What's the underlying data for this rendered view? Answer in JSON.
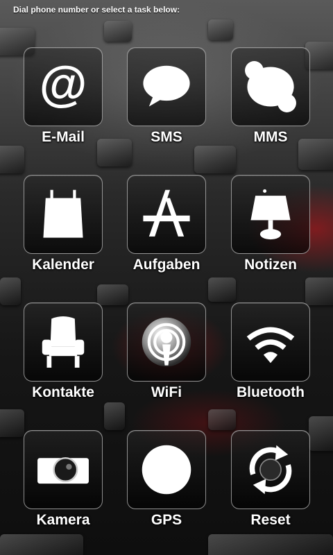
{
  "header": {
    "instruction": "Dial phone number or select a task below:"
  },
  "tiles": [
    {
      "label": "E-Mail",
      "icon": "at-sign-icon"
    },
    {
      "label": "SMS",
      "icon": "speech-bubble-icon"
    },
    {
      "label": "MMS",
      "icon": "skype-cloud-icon"
    },
    {
      "label": "Kalender",
      "icon": "calendar-icon"
    },
    {
      "label": "Aufgaben",
      "icon": "app-store-icon"
    },
    {
      "label": "Notizen",
      "icon": "lamp-icon"
    },
    {
      "label": "Kontakte",
      "icon": "armchair-icon"
    },
    {
      "label": "WiFi",
      "icon": "podcast-icon"
    },
    {
      "label": "Bluetooth",
      "icon": "wifi-signal-icon"
    },
    {
      "label": "Kamera",
      "icon": "camera-icon"
    },
    {
      "label": "GPS",
      "icon": "circle-icon"
    },
    {
      "label": "Reset",
      "icon": "reset-arrows-icon"
    }
  ],
  "colors": {
    "label_text": "#ffffff",
    "tile_border": "#c8c8c8",
    "accent_red": "#c81419"
  }
}
